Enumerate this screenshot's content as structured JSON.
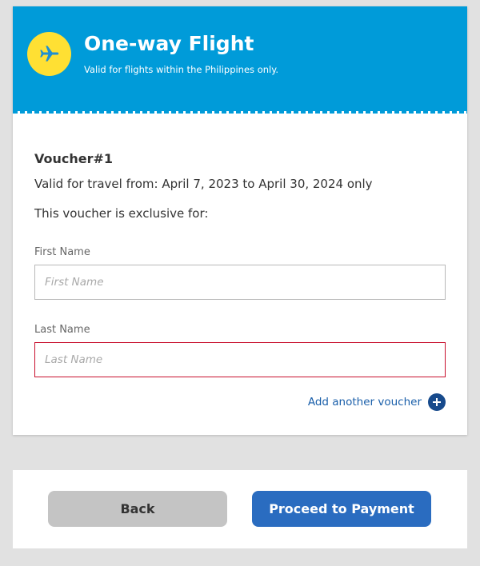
{
  "header": {
    "title": "One-way Flight",
    "subtitle": "Valid for flights within the Philippines only.",
    "icon": "airplane-icon",
    "background_color": "#009bd9",
    "badge_color": "#ffe033"
  },
  "voucher": {
    "label": "Voucher#1",
    "validity": "Valid for travel from: April 7, 2023 to April 30, 2024 only",
    "exclusive_text": "This voucher is exclusive for:"
  },
  "form": {
    "first_name": {
      "label": "First Name",
      "placeholder": "First Name",
      "value": ""
    },
    "last_name": {
      "label": "Last Name",
      "placeholder": "Last Name",
      "value": "",
      "border_color": "#c8102e"
    }
  },
  "add_voucher": {
    "label": "Add another voucher",
    "icon": "plus-circle-icon"
  },
  "buttons": {
    "back": "Back",
    "proceed": "Proceed to Payment",
    "proceed_color": "#2a6cc0"
  }
}
